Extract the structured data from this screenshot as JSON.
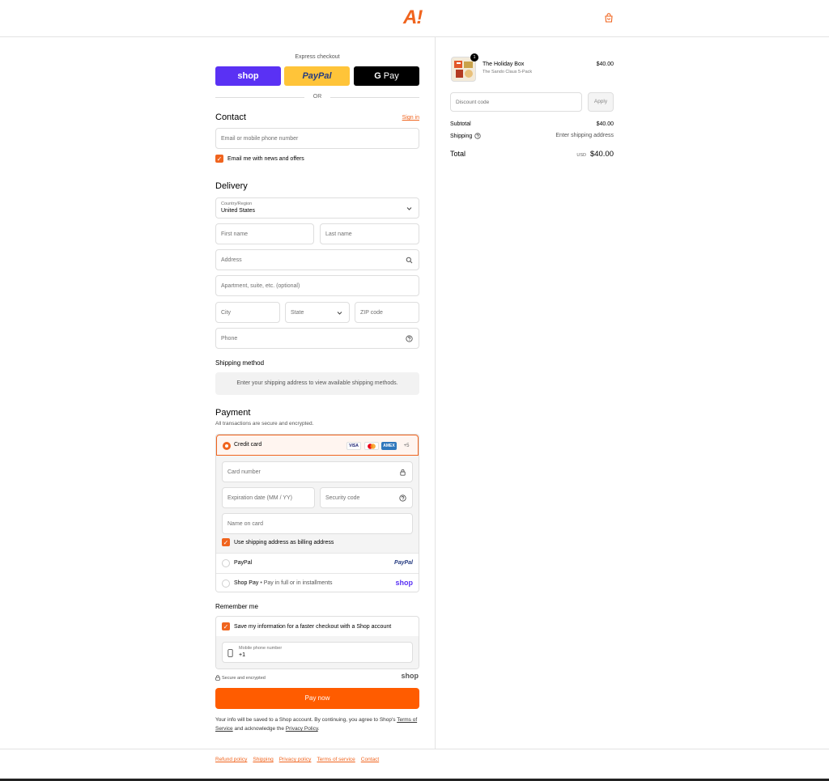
{
  "brand": {
    "logo_text": "A!",
    "accent": "#f0641e",
    "pay_color": "#ff5c00"
  },
  "express": {
    "title": "Express checkout",
    "shop_label": "shop",
    "paypal_label": "PayPal",
    "gpay_label": "Pay",
    "or_text": "OR"
  },
  "contact": {
    "heading": "Contact",
    "sign_in": "Sign in",
    "email_placeholder": "Email or mobile phone number",
    "news_label": "Email me with news and offers"
  },
  "delivery": {
    "heading": "Delivery",
    "country_label": "Country/Region",
    "country_value": "United States",
    "first_name": "First name",
    "last_name": "Last name",
    "address": "Address",
    "apartment": "Apartment, suite, etc. (optional)",
    "city": "City",
    "state": "State",
    "zip": "ZIP code",
    "phone": "Phone"
  },
  "shipping_method": {
    "heading": "Shipping method",
    "message": "Enter your shipping address to view available shipping methods."
  },
  "payment": {
    "heading": "Payment",
    "subtitle": "All transactions are secure and encrypted.",
    "credit_card": "Credit card",
    "card_logos": [
      "VISA",
      "MC",
      "AMEX",
      "+5"
    ],
    "card_number": "Card number",
    "expiration": "Expiration date (MM / YY)",
    "security_code": "Security code",
    "name_on_card": "Name on card",
    "billing_same": "Use shipping address as billing address",
    "paypal": "PayPal",
    "paypal_logo": "PayPal",
    "shop_pay": "Shop Pay",
    "shop_pay_sub": "Pay in full or in installments",
    "shop_logo": "shop"
  },
  "remember": {
    "heading": "Remember me",
    "save_label": "Save my information for a faster checkout with a Shop account",
    "mobile_label": "Mobile phone number",
    "mobile_value": "+1",
    "secure": "Secure and encrypted",
    "shop_logo": "shop"
  },
  "pay_now": "Pay now",
  "legal": {
    "prefix": "Your info will be saved to a Shop account. By continuing, you agree to Shop's ",
    "terms": "Terms of Service",
    "middle": " and acknowledge the ",
    "privacy": "Privacy Policy",
    "suffix": "."
  },
  "footer": [
    "Refund policy",
    "Shipping",
    "Privacy policy",
    "Terms of service",
    "Contact"
  ],
  "summary": {
    "qty": "1",
    "product_name": "The Holiday Box",
    "product_variant": "The Sando Claus 5-Pack",
    "product_price": "$40.00",
    "discount_placeholder": "Discount code",
    "apply": "Apply",
    "subtotal_label": "Subtotal",
    "subtotal_value": "$40.00",
    "shipping_label": "Shipping",
    "shipping_value": "Enter shipping address",
    "total_label": "Total",
    "currency": "USD",
    "total_value": "$40.00"
  }
}
